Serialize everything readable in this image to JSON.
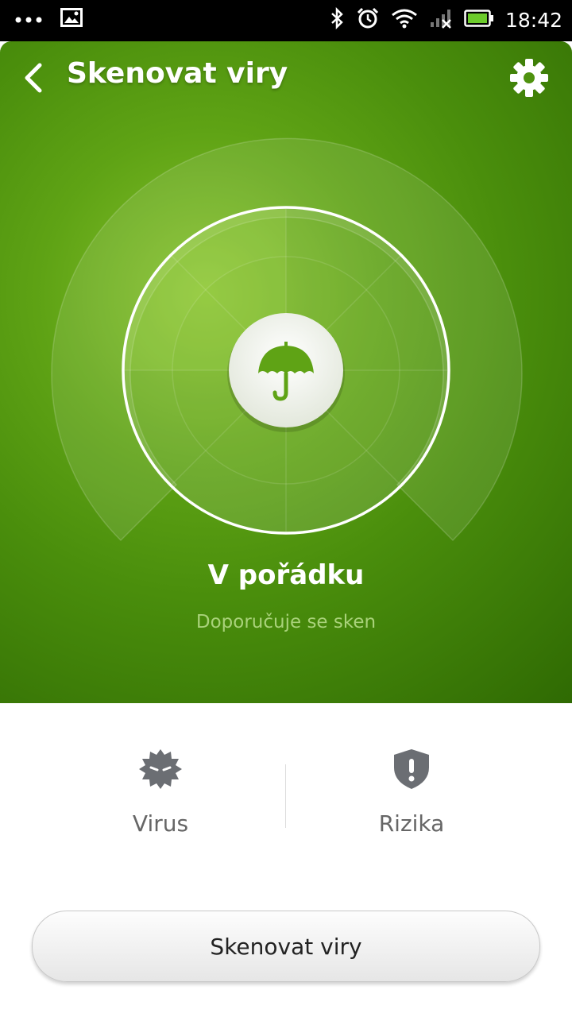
{
  "statusbar": {
    "time": "18:42"
  },
  "header": {
    "title": "Skenovat viry"
  },
  "status": {
    "title": "V pořádku",
    "subtitle": "Doporučuje se sken"
  },
  "stats": [
    {
      "label": "Virus"
    },
    {
      "label": "Rizika"
    }
  ],
  "scan_button": {
    "label": "Skenovat viry"
  },
  "colors": {
    "accent_green": "#5fa315",
    "dark_green": "#2f6a03"
  }
}
